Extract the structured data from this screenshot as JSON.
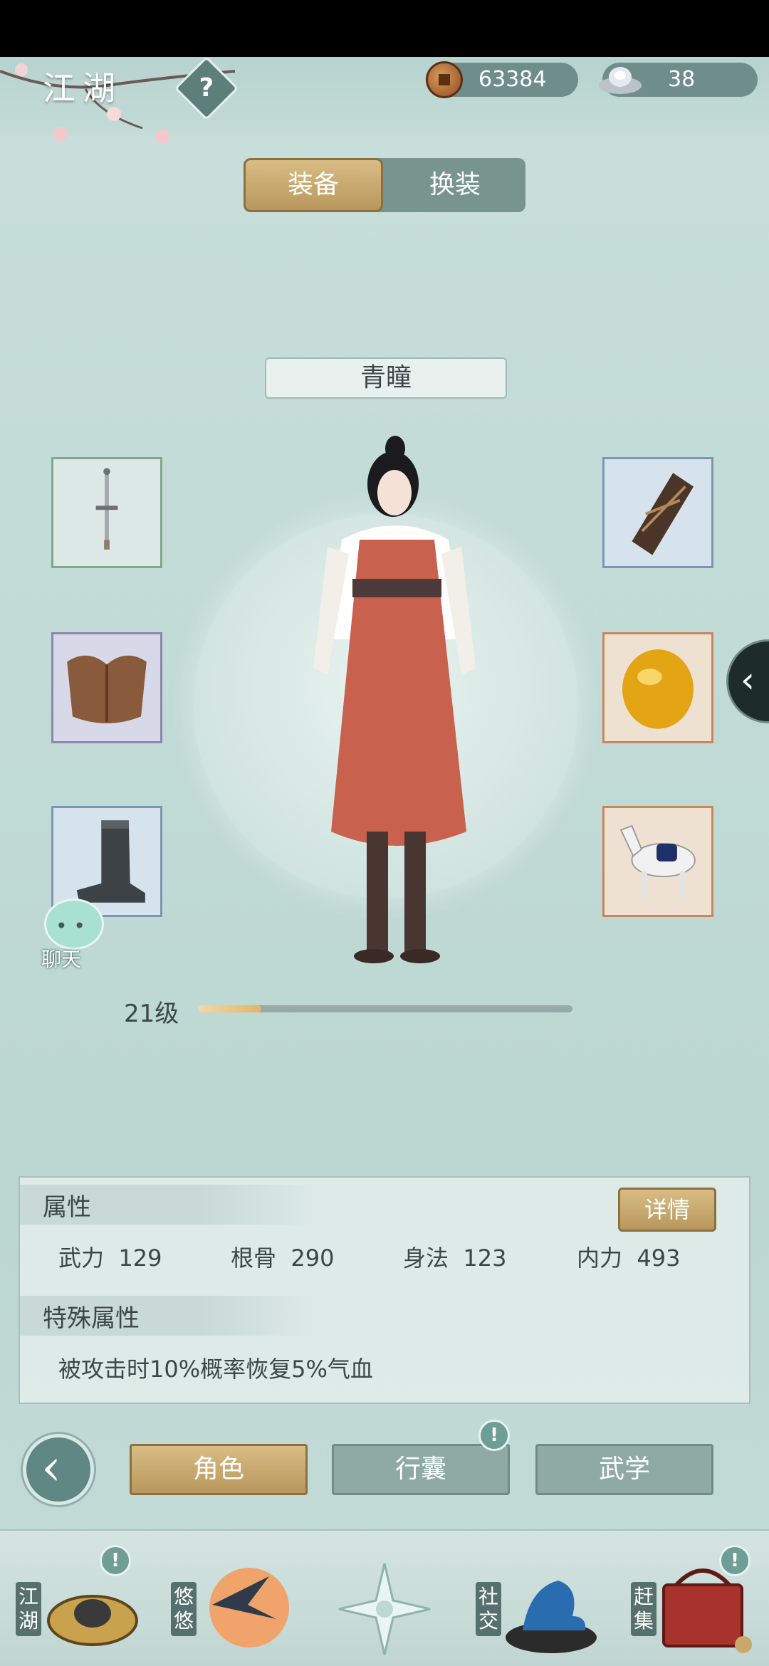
{
  "header": {
    "title": "江湖",
    "copper_amount": "63384",
    "silver_amount": "38"
  },
  "tabs": {
    "equip": "装备",
    "outfit": "换装"
  },
  "character": {
    "name": "青瞳",
    "level_text": "21级",
    "level_progress": 0.17
  },
  "chat": {
    "label": "聊天"
  },
  "attributes": {
    "title": "属性",
    "details_label": "详情",
    "stats": [
      {
        "name": "武力",
        "value": "129"
      },
      {
        "name": "根骨",
        "value": "290"
      },
      {
        "name": "身法",
        "value": "123"
      },
      {
        "name": "内力",
        "value": "493"
      }
    ],
    "special_title": "特殊属性",
    "special_text": "被攻击时10%概率恢复5%气血"
  },
  "nav": {
    "role": "角色",
    "bag": "行囊",
    "martial": "武学"
  },
  "dock": {
    "jianghu": "江湖",
    "youyou": "悠悠",
    "shejiao": "社交",
    "ganji": "赶集"
  },
  "icons": {
    "weapon": "sword-icon",
    "armor": "leather-armor-icon",
    "boots": "boots-icon",
    "bracer": "bracer-icon",
    "accessory": "amber-gem-icon",
    "mount": "white-horse-icon"
  },
  "colors": {
    "accent_gold": "#c8a86c",
    "panel_teal": "#8fa9a5"
  }
}
